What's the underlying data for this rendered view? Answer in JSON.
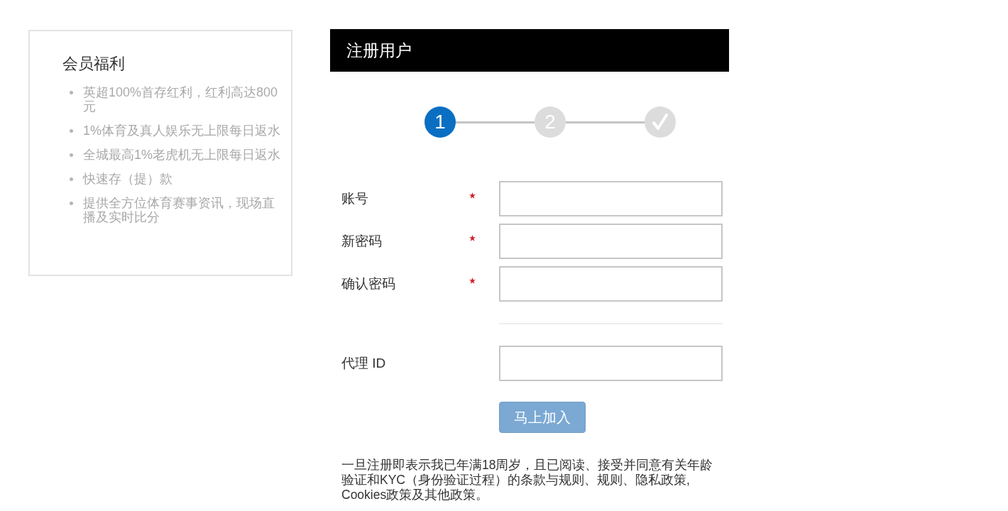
{
  "benefits": {
    "title": "会员福利",
    "items": [
      "英超100%首存红利，红利高达800元",
      "1%体育及真人娱乐无上限每日返水",
      "全城最高1%老虎机无上限每日返水",
      "快速存（提）款",
      "提供全方位体育赛事资讯，现场直播及实时比分"
    ]
  },
  "register": {
    "title": "注册用户",
    "steps": [
      {
        "kind": "number",
        "label": "1",
        "selected": true
      },
      {
        "kind": "number",
        "label": "2",
        "selected": false
      },
      {
        "kind": "check",
        "selected": false
      }
    ],
    "groups": [
      {
        "fields": [
          {
            "label": "账号",
            "required": true
          },
          {
            "label": "新密码",
            "required": true
          },
          {
            "label": "确认密码",
            "required": true
          }
        ]
      },
      {
        "fields": [
          {
            "label": "代理 ID",
            "required": false
          }
        ]
      }
    ],
    "submit": {
      "label": "马上加入",
      "disabled": true
    },
    "disclaimer": "一旦注册即表示我已年满18周岁，且已阅读、接受并同意有关年龄验证和KYC（身份验证过程）的条款与规则、规则、隐私政策, Cookies政策及其他政策。"
  }
}
